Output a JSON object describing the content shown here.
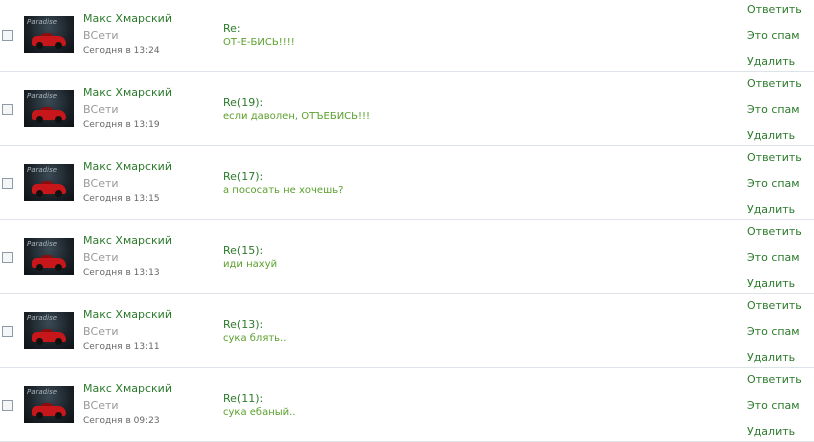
{
  "messages": [
    {
      "sender": "Макс Хмарский",
      "status": "ВСети",
      "date": "Сегодня в 13:24",
      "subject": "Re:",
      "text": "ОТ-Е-БИСЬ!!!!",
      "avatar_caption": "Paradise",
      "reply": "Ответить",
      "spam": "Это спам",
      "delete": "Удалить"
    },
    {
      "sender": "Макс Хмарский",
      "status": "ВСети",
      "date": "Сегодня в 13:19",
      "subject": "Re(19):",
      "text": "если даволен, ОТЪЕБИСЬ!!!",
      "avatar_caption": "Paradise",
      "reply": "Ответить",
      "spam": "Это спам",
      "delete": "Удалить"
    },
    {
      "sender": "Макс Хмарский",
      "status": "ВСети",
      "date": "Сегодня в 13:15",
      "subject": "Re(17):",
      "text": "а пососать не хочешь?",
      "avatar_caption": "Paradise",
      "reply": "Ответить",
      "spam": "Это спам",
      "delete": "Удалить"
    },
    {
      "sender": "Макс Хмарский",
      "status": "ВСети",
      "date": "Сегодня в 13:13",
      "subject": "Re(15):",
      "text": "иди нахуй",
      "avatar_caption": "Paradise",
      "reply": "Ответить",
      "spam": "Это спам",
      "delete": "Удалить"
    },
    {
      "sender": "Макс Хмарский",
      "status": "ВСети",
      "date": "Сегодня в 13:11",
      "subject": "Re(13):",
      "text": "сука блять..",
      "avatar_caption": "Paradise",
      "reply": "Ответить",
      "spam": "Это спам",
      "delete": "Удалить"
    },
    {
      "sender": "Макс Хмарский",
      "status": "ВСети",
      "date": "Сегодня в 09:23",
      "subject": "Re(11):",
      "text": "сука ебаный..",
      "avatar_caption": "Paradise",
      "reply": "Ответить",
      "spam": "Это спам",
      "delete": "Удалить"
    }
  ],
  "colors": {
    "link_green": "#2b7a2b",
    "text_green": "#5aa02c",
    "muted": "#999999",
    "date": "#666666",
    "separator": "#dde3e8"
  }
}
